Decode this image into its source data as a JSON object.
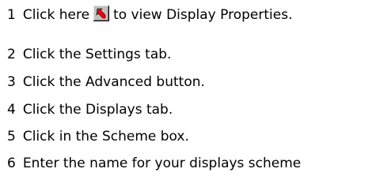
{
  "steps": [
    {
      "number": "1",
      "text_before": "Click here",
      "text_after": "to view Display Properties."
    },
    {
      "number": "2",
      "text": "Click the Settings tab."
    },
    {
      "number": "3",
      "text": "Click the Advanced button."
    },
    {
      "number": "4",
      "text": "Click the Displays tab."
    },
    {
      "number": "5",
      "text": "Click in the Scheme box."
    },
    {
      "number": "6",
      "text": "Enter the name for your displays scheme"
    }
  ],
  "shortcut_icon": "shortcut-arrow-icon",
  "colors": {
    "icon_bg": "#c0c0c0",
    "icon_arrow": "#ff0000",
    "text": "#000000"
  }
}
